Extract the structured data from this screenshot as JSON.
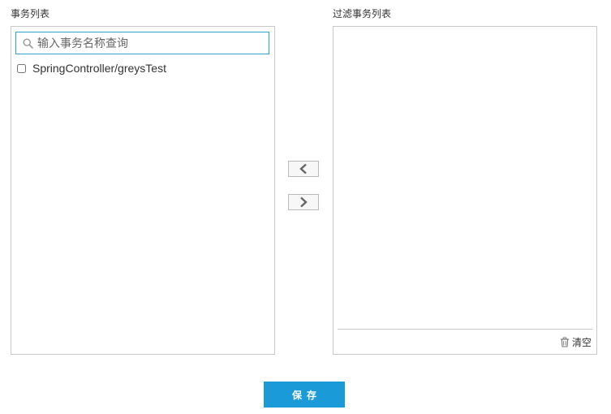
{
  "left_panel": {
    "title": "事务列表",
    "search": {
      "placeholder": "输入事务名称查询",
      "value": ""
    },
    "items": [
      {
        "label": "SpringController/greysTest",
        "checked": false
      }
    ]
  },
  "right_panel": {
    "title": "过滤事务列表",
    "clear_label": "清空"
  },
  "transfer": {
    "move_left_icon": "chevron-left-icon",
    "move_right_icon": "chevron-right-icon"
  },
  "actions": {
    "save_label": "保存"
  },
  "colors": {
    "accent": "#1a9bd8",
    "search_border": "#2ba6cb",
    "panel_border": "#c8c8c8"
  }
}
